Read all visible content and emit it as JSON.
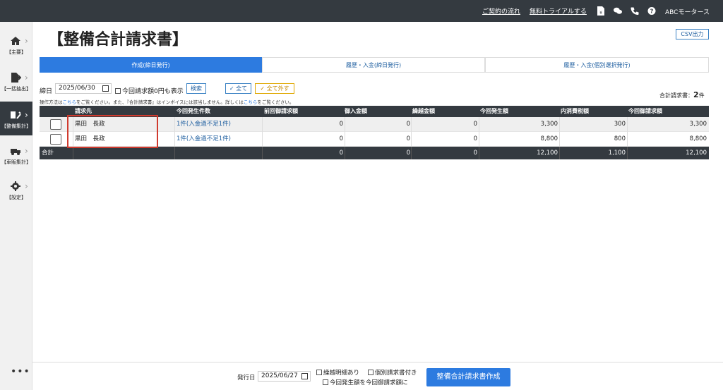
{
  "topbar": {
    "links": [
      "ご契約の流れ",
      "無料トライアルする"
    ],
    "company": "ABCモータース"
  },
  "sidebar": {
    "items": [
      {
        "label": "【主要】",
        "icon": "home-icon",
        "active": false
      },
      {
        "label": "【一括抽出】",
        "icon": "file-export-icon",
        "active": false
      },
      {
        "label": "【整備集計】",
        "icon": "tools-icon",
        "active": true
      },
      {
        "label": "【車販集計】",
        "icon": "car-icon",
        "active": false
      },
      {
        "label": "【設定】",
        "icon": "gear-icon",
        "active": false
      }
    ],
    "more": "•••"
  },
  "page": {
    "title": "【整備合計請求書】",
    "csv_button": "CSV出力"
  },
  "tabs": [
    "作成(締日発行)",
    "履歴・入金(締日発行)",
    "履歴・入金(個別選択発行)"
  ],
  "filter": {
    "date_label": "締日",
    "date_value": "2025/06/30",
    "zero_label": "今回請求額0円も表示",
    "search_button": "検索",
    "all_button": "✓ 全て",
    "none_button": "✓ 全て外す"
  },
  "note": {
    "part1": "操作方法は",
    "link1": "こちら",
    "part2": "をご覧ください。また、『合計請求書』はインボイスには該当しません。詳しくは",
    "link2": "こちら",
    "part3": "をご覧ください。"
  },
  "count": {
    "label": "合計請求書：",
    "value": "2",
    "unit": "件"
  },
  "table": {
    "headers": [
      "請求先",
      "今回発生件数",
      "前回御請求額",
      "御入金額",
      "繰越金額",
      "今回発生額",
      "内消費税額",
      "今回御請求額"
    ],
    "rows": [
      {
        "name": "黒田　長政",
        "count": "1件(入金過不足1件)",
        "prev": "0",
        "paid": "0",
        "carry": "0",
        "current": "3,300",
        "tax": "300",
        "total": "3,300"
      },
      {
        "name": "黒田　長政",
        "count": "1件(入金過不足1件)",
        "prev": "0",
        "paid": "0",
        "carry": "0",
        "current": "8,800",
        "tax": "800",
        "total": "8,800"
      }
    ],
    "footer": {
      "label": "合計",
      "prev": "0",
      "paid": "0",
      "carry": "0",
      "current": "12,100",
      "tax": "1,100",
      "total": "12,100"
    }
  },
  "bottom": {
    "issue_date_label": "発行日",
    "issue_date_value": "2025/06/27",
    "opt_carry": "繰越明細あり",
    "opt_individual": "個別請求書付き",
    "opt_current": "今回発生額を今回御請求額に",
    "create_button": "整備合計請求書作成"
  }
}
